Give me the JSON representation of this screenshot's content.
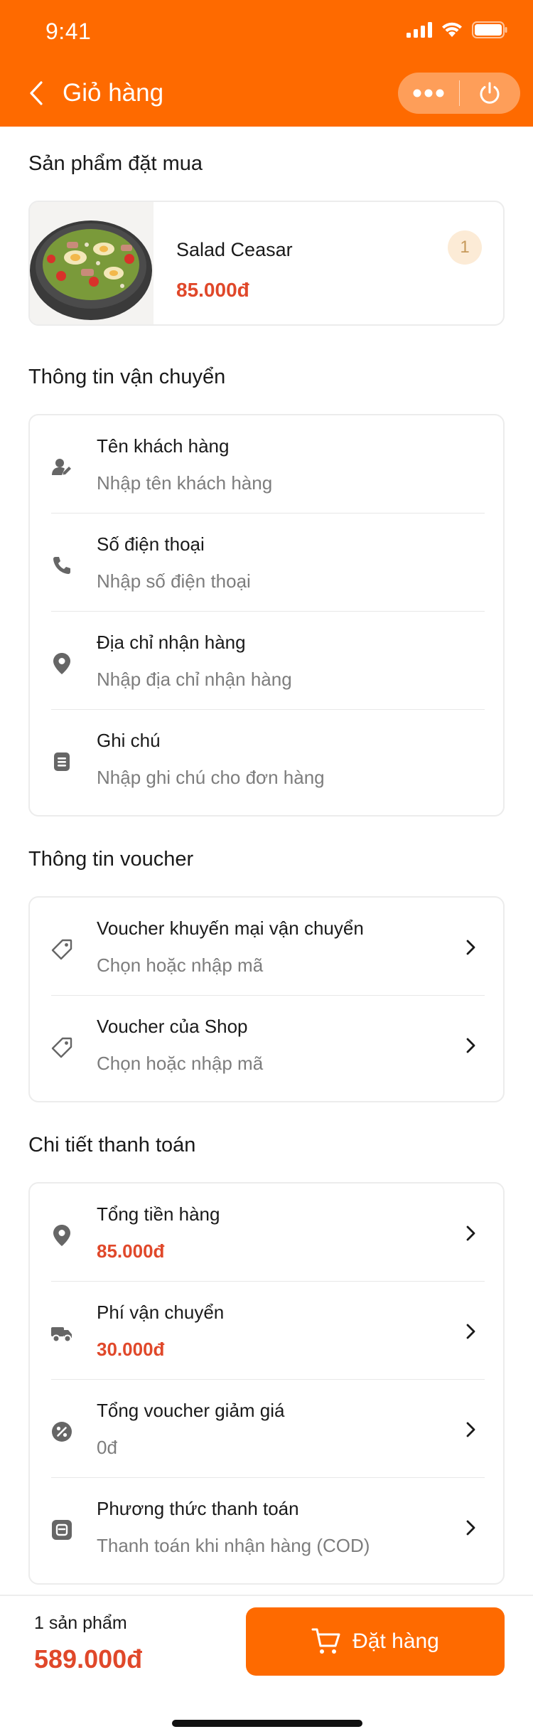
{
  "status_bar": {
    "time": "9:41"
  },
  "nav": {
    "title": "Giỏ hàng"
  },
  "sections": {
    "products": "Sản phẩm đặt mua",
    "shipping": "Thông tin vận chuyển",
    "voucher": "Thông tin voucher",
    "payment": "Chi tiết thanh toán"
  },
  "product": {
    "name": "Salad Ceasar",
    "price": "85.000đ",
    "quantity": "1"
  },
  "shipping_fields": [
    {
      "label": "Tên khách hàng",
      "placeholder": "Nhập tên khách hàng",
      "icon": "user-icon"
    },
    {
      "label": "Số điện thoại",
      "placeholder": "Nhập số điện thoại",
      "icon": "phone-icon"
    },
    {
      "label": "Địa chỉ nhận hàng",
      "placeholder": "Nhập địa chỉ nhận hàng",
      "icon": "location-pin-icon"
    },
    {
      "label": "Ghi chú",
      "placeholder": "Nhập ghi chú cho đơn hàng",
      "icon": "note-icon"
    }
  ],
  "vouchers": [
    {
      "label": "Voucher khuyến mại vận chuyển",
      "value": "Chọn hoặc nhập mã",
      "icon": "tag-icon"
    },
    {
      "label": "Voucher của Shop",
      "value": "Chọn hoặc nhập mã",
      "icon": "tag-icon"
    }
  ],
  "payment_rows": [
    {
      "label": "Tổng tiền hàng",
      "value": "85.000đ",
      "icon": "location-pin-icon"
    },
    {
      "label": "Phí vận chuyển",
      "value": "30.000đ",
      "icon": "delivery-truck-icon"
    },
    {
      "label": "Tổng voucher giảm giá",
      "value": "0đ",
      "icon": "discount-icon"
    },
    {
      "label": "Phương thức thanh toán",
      "value": "Thanh toán khi nhận hàng (COD)",
      "icon": "wallet-icon"
    }
  ],
  "footer": {
    "count": "1 sản phẩm",
    "total": "589.000đ",
    "order_label": "Đặt hàng"
  },
  "colors": {
    "brand": "#fe6a00",
    "price": "#e0482a",
    "muted": "#7d7d7d"
  }
}
